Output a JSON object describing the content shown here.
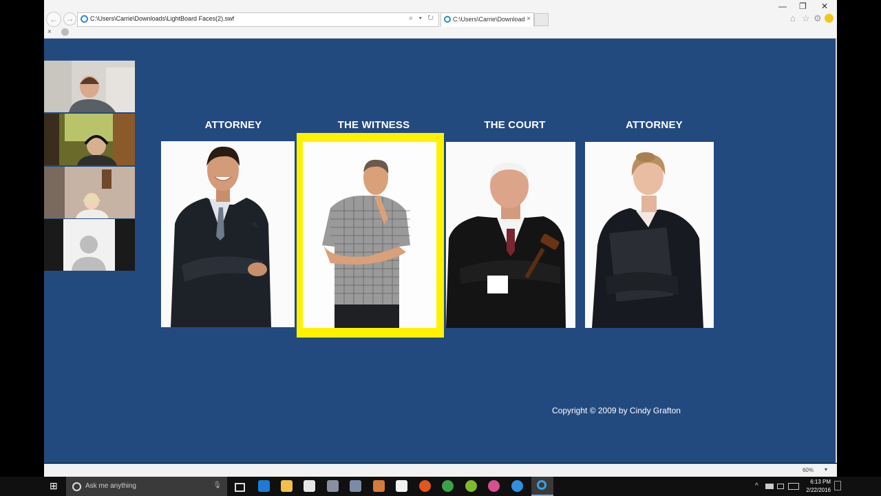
{
  "browser": {
    "address_url": "C:\\Users\\Carrie\\Downloads\\LightBoard Faces(2).swf",
    "address_tools": "⌕ ▾ ↻",
    "tab_title": "C:\\Users\\Carrie\\Downloads...",
    "tab_close": "×",
    "back": "←",
    "forward": "→",
    "minimize": "—",
    "restore": "❐",
    "close": "✕",
    "home_icon": "⌂",
    "favorites_icon": "☆",
    "settings_icon": "⚙",
    "row2_close": "×"
  },
  "page": {
    "headings": [
      "ATTORNEY",
      "THE WITNESS",
      "THE COURT",
      "ATTORNEY"
    ],
    "copyright": "Copyright © 2009 by Cindy Grafton",
    "selected_card": "THE WITNESS",
    "highlight_color": "#fff200",
    "background_color": "#234a7f"
  },
  "statusbar": {
    "zoom": "60%",
    "zoom_arrow": "▾"
  },
  "taskbar": {
    "search_placeholder": "Ask me anything",
    "mic": "🎙",
    "start": "⊞",
    "time": "6:13 PM",
    "date": "2/22/2016",
    "tray_up": "^"
  },
  "icons": {
    "cursor": "⇖"
  }
}
